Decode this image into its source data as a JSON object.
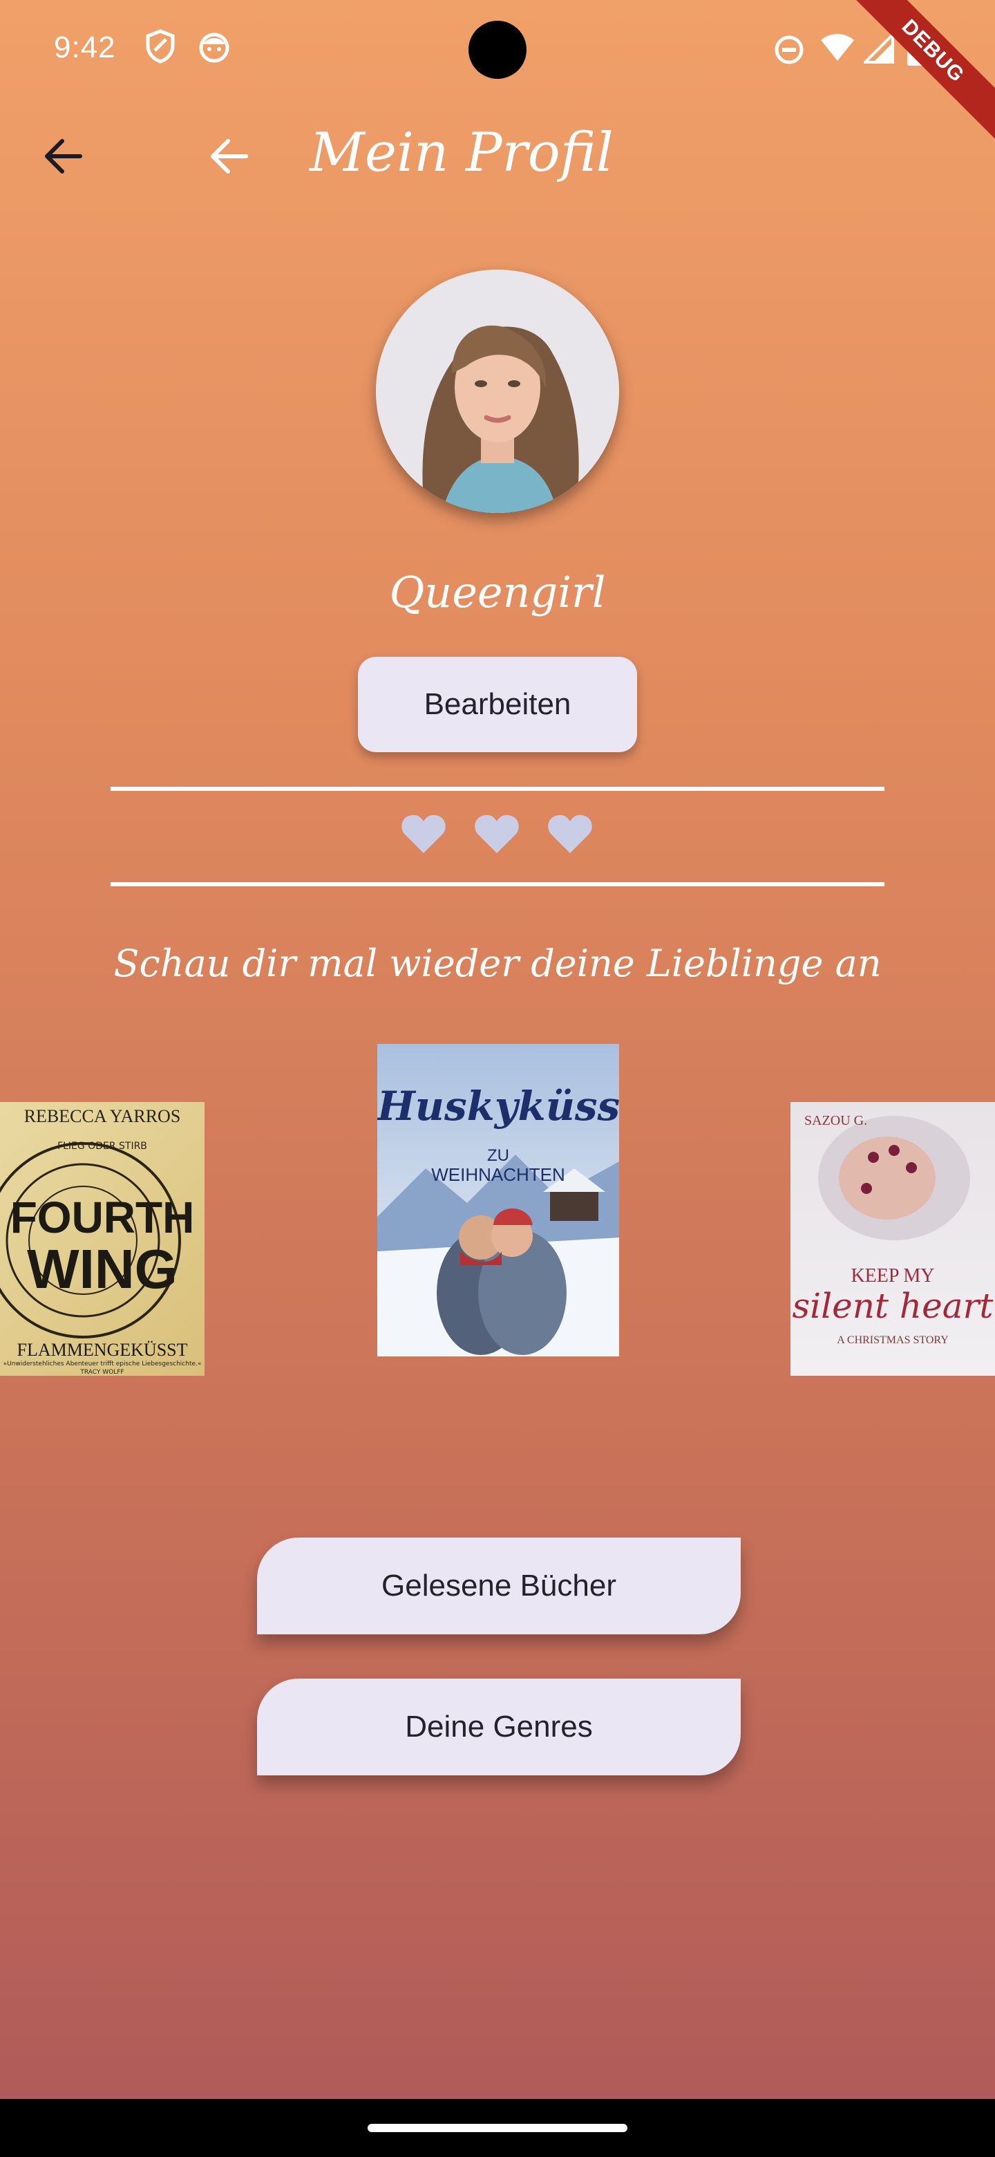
{
  "status_bar": {
    "time": "9:42",
    "debug_label": "DEBUG"
  },
  "app_bar": {
    "title": "Mein Profil"
  },
  "profile": {
    "username": "Queengirl",
    "edit_label": "Bearbeiten",
    "hearts": [
      "heart-icon",
      "heart-icon",
      "heart-icon"
    ]
  },
  "favorites": {
    "heading": "Schau dir mal wieder deine Lieblinge an",
    "books": [
      {
        "author": "REBECCA YARROS",
        "title_line1": "FOURTH",
        "title_line2": "WING",
        "subtitle": "FLAMMENGEKÜSST",
        "tagline": "»Unwiderstehliches Abenteuer trifft epische Liebesgeschichte.«",
        "blurb_author": "TRACY WOLFF",
        "small": "FLIEG ODER STIRB"
      },
      {
        "title": "Huskyküsse",
        "subtitle1": "ZU",
        "subtitle2": "WEIHNACHTEN"
      },
      {
        "author": "SAZOU G.",
        "title_line1": "KEEP MY",
        "title_line2": "silent heart",
        "subtitle": "A CHRISTMAS STORY"
      }
    ]
  },
  "actions": {
    "read_books": "Gelesene Bücher",
    "genres": "Deine Genres"
  },
  "colors": {
    "button_bg": "#eae6f3",
    "heart": "#c9cde6",
    "text_dark": "#26222b"
  }
}
